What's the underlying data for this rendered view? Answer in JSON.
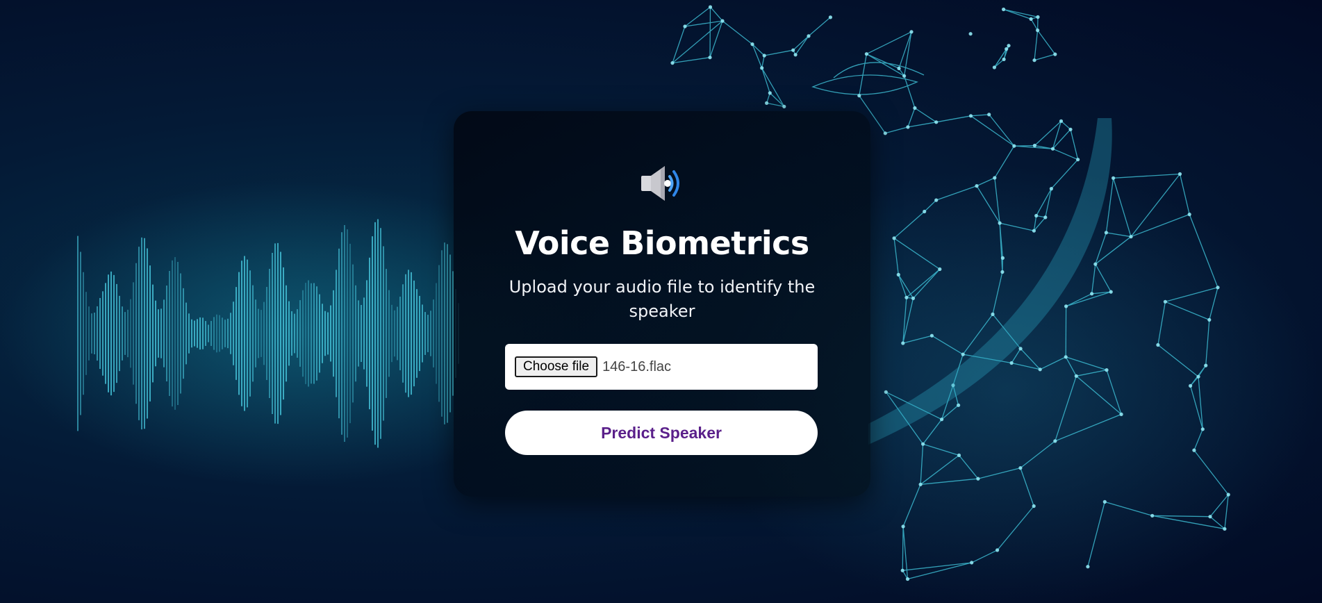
{
  "page": {
    "icon": "speaker-volume-icon",
    "title": "Voice Biometrics",
    "subtitle": "Upload your audio file to identify the speaker"
  },
  "upload": {
    "choose_label": "Choose file",
    "file_name": "146-16.flac"
  },
  "actions": {
    "predict_label": "Predict Speaker"
  },
  "colors": {
    "background": "#041a36",
    "accent_cyan": "#3fc3d9",
    "button_text": "#5a1f8a"
  }
}
